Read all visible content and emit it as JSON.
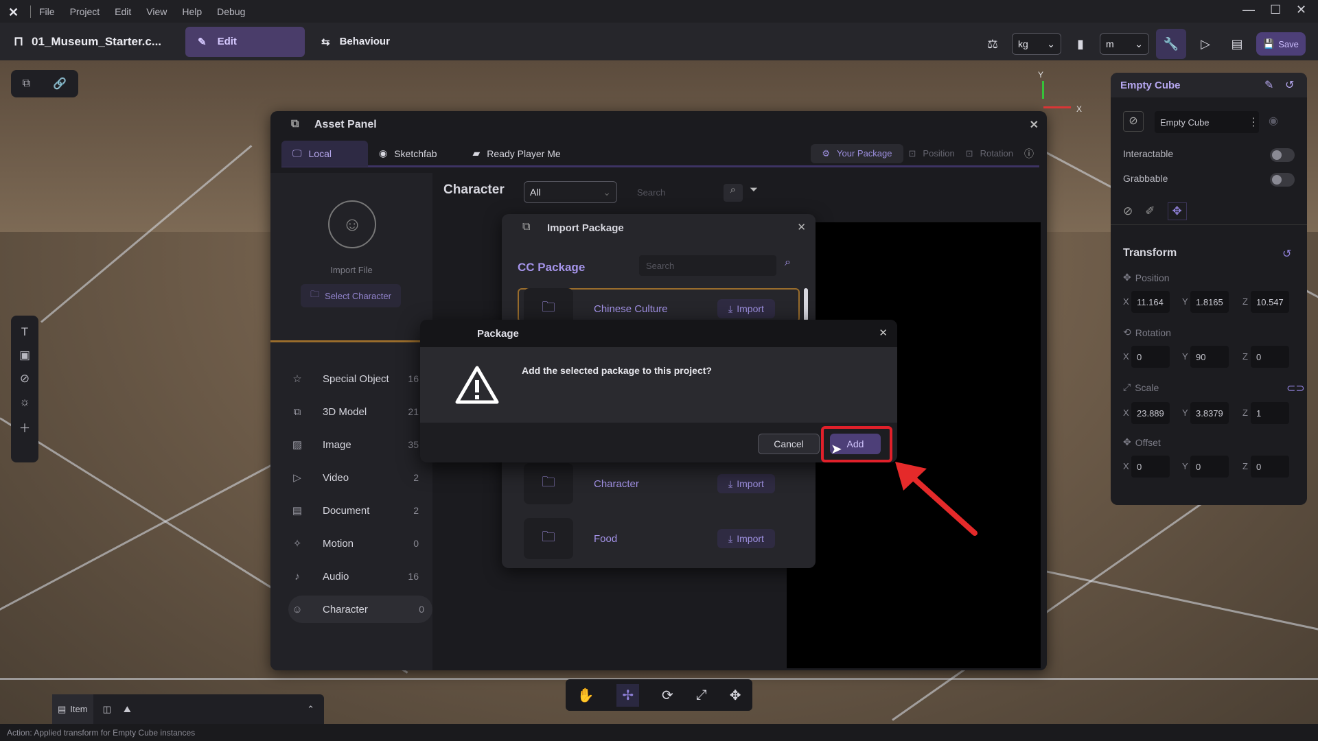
{
  "menubar": {
    "items": [
      "File",
      "Project",
      "Edit",
      "View",
      "Help",
      "Debug"
    ]
  },
  "toolbar": {
    "project_name": "01_Museum_Starter.c...",
    "edit_label": "Edit",
    "behaviour_label": "Behaviour",
    "mass_unit": "kg",
    "length_unit": "m",
    "save_label": "Save"
  },
  "asset_panel": {
    "title": "Asset Panel",
    "tabs": [
      "Local",
      "Sketchfab",
      "Ready Player Me"
    ],
    "your_package": "Your Package",
    "position": "Position",
    "rotation": "Rotation",
    "category_title": "Character",
    "filter_value": "All",
    "search_placeholder": "Search",
    "import_file": "Import File",
    "select_character": "Select Character",
    "categories": [
      {
        "label": "Special Object",
        "count": "16",
        "icon": "star-icon"
      },
      {
        "label": "3D Model",
        "count": "21",
        "icon": "cube-icon"
      },
      {
        "label": "Image",
        "count": "35",
        "icon": "image-icon"
      },
      {
        "label": "Video",
        "count": "2",
        "icon": "play-icon"
      },
      {
        "label": "Document",
        "count": "2",
        "icon": "document-icon"
      },
      {
        "label": "Motion",
        "count": "0",
        "icon": "motion-icon"
      },
      {
        "label": "Audio",
        "count": "16",
        "icon": "audio-icon"
      },
      {
        "label": "Character",
        "count": "0",
        "icon": "character-icon"
      }
    ]
  },
  "import_package": {
    "title": "Import Package",
    "section": "CC Package",
    "search_placeholder": "Search",
    "import_label": "Import",
    "packages": [
      "Chinese Culture",
      "Character",
      "Food"
    ]
  },
  "package_dialog": {
    "title": "Package",
    "message": "Add the selected package to this project?",
    "cancel": "Cancel",
    "add": "Add"
  },
  "inspector": {
    "title": "Empty Cube",
    "object_name": "Empty Cube",
    "interactable": "Interactable",
    "grabbable": "Grabbable",
    "transform": "Transform",
    "position_label": "Position",
    "rotation_label": "Rotation",
    "scale_label": "Scale",
    "offset_label": "Offset",
    "position": {
      "x": "11.164",
      "y": "1.8165",
      "z": "10.547"
    },
    "rotation": {
      "x": "0",
      "y": "90",
      "z": "0"
    },
    "scale": {
      "x": "23.889",
      "y": "3.8379",
      "z": "1"
    },
    "offset": {
      "x": "0",
      "y": "0",
      "z": "0"
    }
  },
  "gizmo": {
    "y": "Y",
    "x": "X"
  },
  "bottom": {
    "item_label": "Item"
  },
  "status": "Action: Applied transform for Empty Cube instances",
  "colors": {
    "accent": "#4d3f78",
    "accent_text": "#a594ea",
    "highlight": "#e0202a"
  }
}
